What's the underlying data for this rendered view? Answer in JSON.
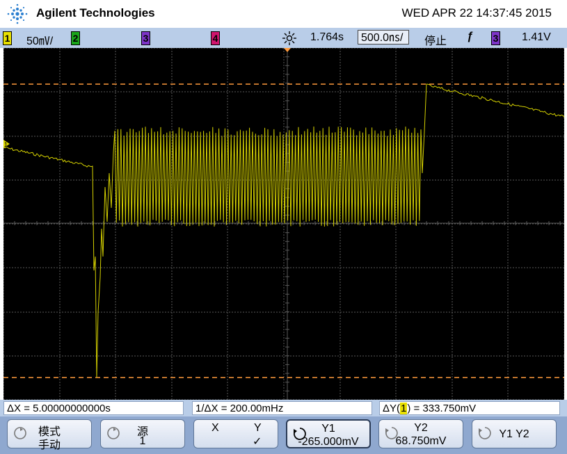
{
  "header": {
    "brand": "Agilent Technologies",
    "datetime": "WED APR 22 14:37:45 2015"
  },
  "status": {
    "ch1_num": "1",
    "ch1_scale": "50㎷/",
    "ch2_num": "2",
    "ch3_num": "3",
    "ch4_num": "4",
    "delay": "1.764s",
    "timebase": "500.0㎱/",
    "run_state": "停止",
    "trigger_edge_symbol": "ƒ",
    "trigger_channel": "3",
    "trigger_level": "1.41V"
  },
  "screen": {
    "ch1_marker": "1",
    "colors": {
      "trace": "#d6d200",
      "cursor": "#ff9a3c",
      "grid": "#5a5a5a",
      "ch3_marker": "#7d34c8"
    }
  },
  "measurements": {
    "delta_x": "ΔX = 5.00000000000s",
    "inv_delta_x": "1/ΔX = 200.00mHz",
    "delta_y_prefix": "ΔY(",
    "delta_y_channel": "1",
    "delta_y_suffix": ") = 333.750mV"
  },
  "softkeys": {
    "mode_label": "模式",
    "mode_value": "手动",
    "source_label": "源",
    "source_value": "1",
    "x_label": "X",
    "y_label": "Y",
    "y_check": "✓",
    "y1_label": "Y1",
    "y1_value": "-265.000mV",
    "y2_label": "Y2",
    "y2_value": "68.750mV",
    "y1y2_label": "Y1 Y2"
  }
}
